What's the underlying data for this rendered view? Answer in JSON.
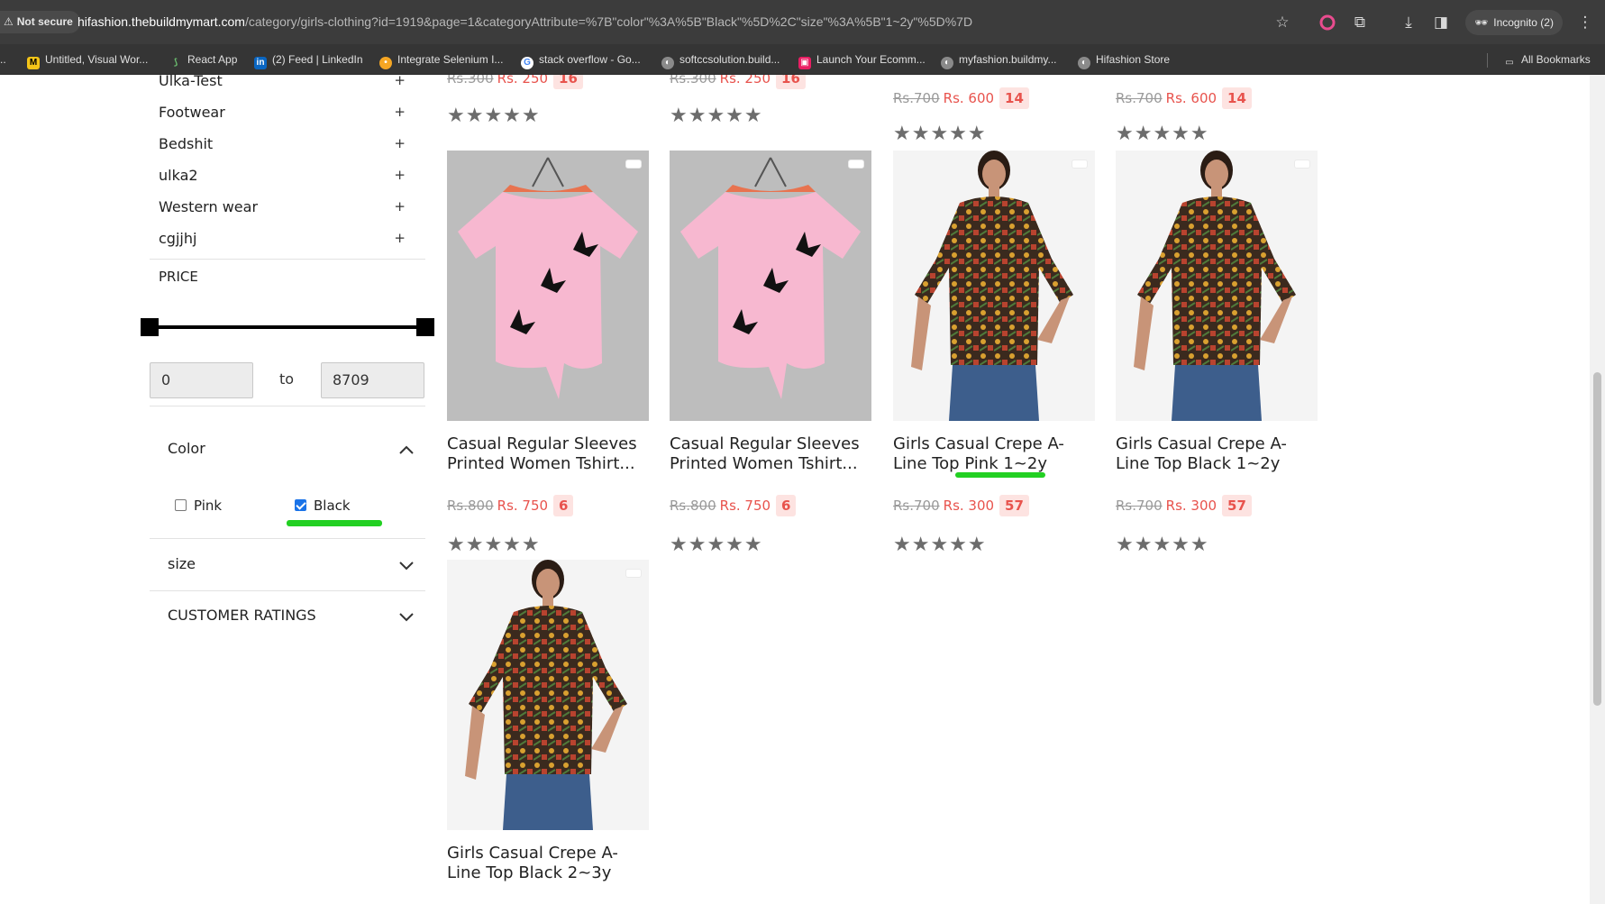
{
  "browser": {
    "security_label": "Not secure",
    "url_host": "hifashion.thebuildmymart.com",
    "url_path": "/category/girls-clothing?id=1919&page=1&categoryAttribute=%7B\"color\"%3A%5B\"Black\"%5D%2C\"size\"%3A%5B\"1~2y\"%5D%7D",
    "incognito_label": "Incognito (2)",
    "bookmarks": [
      {
        "label": "Untitled, Visual Wor...",
        "color": "#f5c518",
        "glyph": "M"
      },
      {
        "label": "React App",
        "color": "#2e7d32",
        "glyph": "✦"
      },
      {
        "label": "(2) Feed | LinkedIn",
        "color": "#0a66c2",
        "glyph": "in"
      },
      {
        "label": "Integrate Selenium I...",
        "color": "#f5a623",
        "glyph": "●"
      },
      {
        "label": "stack overflow - Go...",
        "color": "#ffffff",
        "glyph": "G"
      },
      {
        "label": "softccsolution.build...",
        "color": "#9e9e9e",
        "glyph": "◐"
      },
      {
        "label": "Launch Your Ecomm...",
        "color": "#e91e63",
        "glyph": "▣"
      },
      {
        "label": "myfashion.buildmy...",
        "color": "#9e9e9e",
        "glyph": "◐"
      },
      {
        "label": "Hifashion Store",
        "color": "#9e9e9e",
        "glyph": "◐"
      },
      {
        "label": "All Bookmarks",
        "color": "#9e9e9e",
        "glyph": "▭"
      }
    ]
  },
  "sidebar": {
    "categories": [
      {
        "label": "Ulka-Test"
      },
      {
        "label": "Footwear"
      },
      {
        "label": "Bedshit"
      },
      {
        "label": "ulka2"
      },
      {
        "label": "Western wear"
      },
      {
        "label": "cgjjhj"
      }
    ],
    "plus_glyph": "+",
    "price_title": "PRICE",
    "price_min": "0",
    "price_max": "8709",
    "price_to": "to",
    "color_title": "Color",
    "color_options": [
      {
        "label": "Pink",
        "checked": false
      },
      {
        "label": "Black",
        "checked": true
      }
    ],
    "size_title": "size",
    "ratings_title": "CUSTOMER RATINGS"
  },
  "top_row_prices": [
    {
      "old": "Rs.300",
      "new": "Rs. 250",
      "disc": "16"
    },
    {
      "old": "Rs.300",
      "new": "Rs. 250",
      "disc": "16"
    },
    {
      "old": "Rs.700",
      "new": "Rs. 600",
      "disc": "14"
    },
    {
      "old": "Rs.700",
      "new": "Rs. 600",
      "disc": "14"
    }
  ],
  "stars": "★★★★★",
  "products": [
    {
      "line1": "Casual Regular Sleeves",
      "line2": "Printed Women Tshirt...",
      "old": "Rs.800",
      "new": "Rs. 750",
      "disc": "6"
    },
    {
      "line1": "Casual Regular Sleeves",
      "line2": "Printed Women Tshirt...",
      "old": "Rs.800",
      "new": "Rs. 750",
      "disc": "6"
    },
    {
      "line1": "Girls Casual Crepe A-",
      "line2": "Line Top Pink 1~2y",
      "old": "Rs.700",
      "new": "Rs. 300",
      "disc": "57"
    },
    {
      "line1": "Girls Casual Crepe A-",
      "line2": "Line Top Black 1~2y",
      "old": "Rs.700",
      "new": "Rs. 300",
      "disc": "57"
    },
    {
      "line1": "Girls Casual Crepe A-",
      "line2": "Line Top Black 2~3y"
    }
  ],
  "colors": {
    "accent_green": "#22d022",
    "price_red": "#e8534d",
    "tee_pink": "#f7b8d0"
  }
}
